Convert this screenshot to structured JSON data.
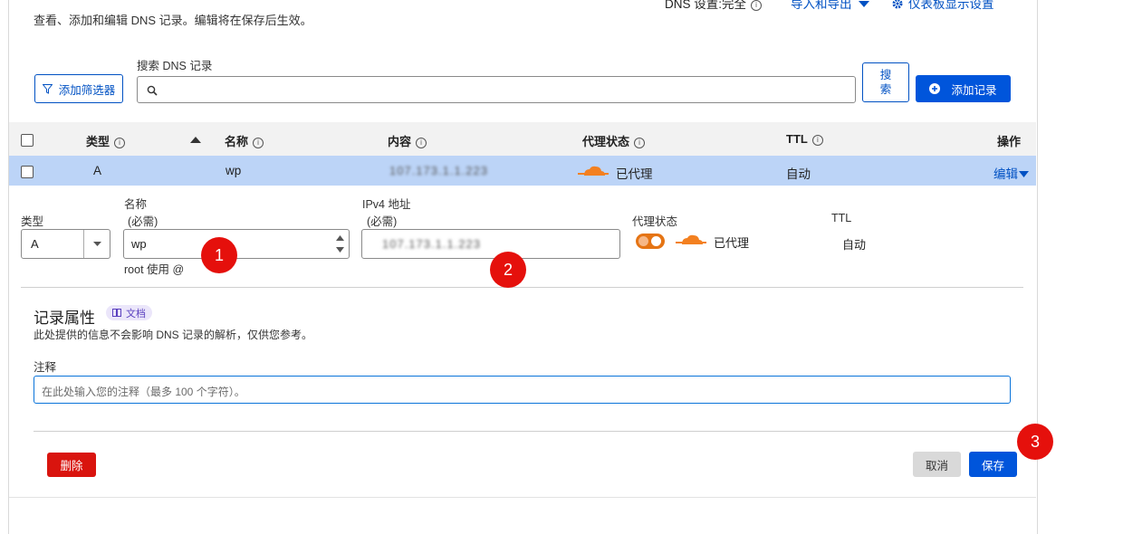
{
  "header": {
    "subtitle": "查看、添加和编辑 DNS 记录。编辑将在保存后生效。",
    "dns_setting_label": "DNS 设置:完全",
    "import_export": "导入和导出",
    "dashboard_settings": "仪表板显示设置"
  },
  "toolbar": {
    "filter_button": "添加筛选器",
    "search_label": "搜索 DNS 记录",
    "search_button": "搜索",
    "add_record_button": "添加记录"
  },
  "table": {
    "headers": {
      "type": "类型",
      "name": "名称",
      "content": "内容",
      "proxy": "代理状态",
      "ttl": "TTL",
      "actions": "操作"
    },
    "row": {
      "type": "A",
      "name": "wp",
      "content": "107.173.1.1.223",
      "proxy": "已代理",
      "ttl": "自动",
      "action": "编辑"
    }
  },
  "edit_form": {
    "type_label": "类型",
    "type_value": "A",
    "name_label": "名称",
    "name_required": "(必需)",
    "name_value": "wp",
    "name_hint": "root 使用 @",
    "ipv4_label": "IPv4 地址",
    "ipv4_required": "(必需)",
    "ipv4_value": "107.173.1.1.223",
    "proxy_label": "代理状态",
    "proxy_value": "已代理",
    "ttl_label": "TTL",
    "ttl_value": "自动"
  },
  "record_attributes": {
    "title": "记录属性",
    "docs_badge": "文档",
    "description": "此处提供的信息不会影响 DNS 记录的解析，仅供您参考。",
    "comment_label": "注释",
    "comment_placeholder": "在此处输入您的注释（最多 100 个字符）。"
  },
  "footer": {
    "delete_button": "删除",
    "cancel_button": "取消",
    "save_button": "保存"
  },
  "annotations": [
    "1",
    "2",
    "3"
  ],
  "colors": {
    "primary": "#0055db",
    "danger": "#d9140e",
    "badge": "#e5100c",
    "proxy_orange": "#f38020",
    "selected_row": "#bcd4f7"
  }
}
